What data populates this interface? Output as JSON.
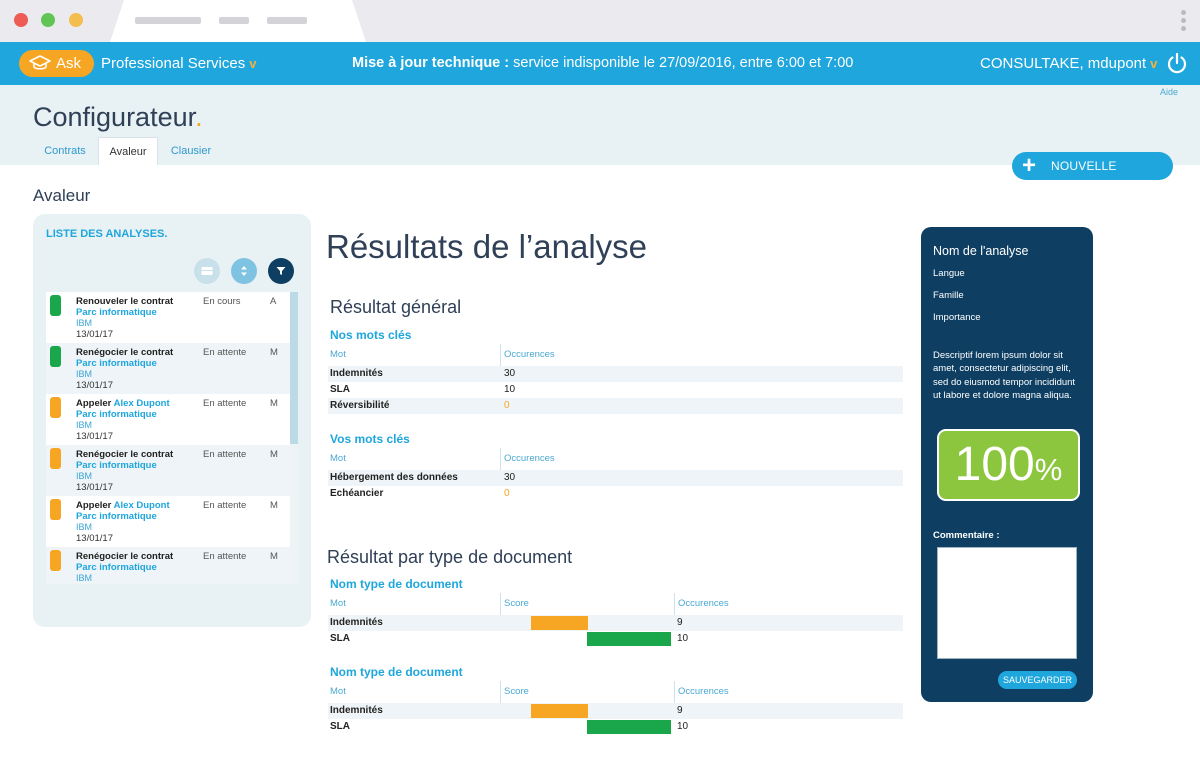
{
  "browser": {},
  "topbar": {
    "ask_label": "Ask",
    "org": "Professional Services",
    "org_chevron": "v",
    "notice_bold": "Mise à jour technique :",
    "notice_text": " service indisponible le 27/09/2016, entre 6:00 et 7:00",
    "user": "CONSULTAKE, mdupont",
    "user_chevron": "v",
    "help": "Aide"
  },
  "header": {
    "title": "Configurateur",
    "title_dot": ".",
    "tabs": [
      {
        "label": "Contrats"
      },
      {
        "label": "Avaleur"
      },
      {
        "label": "Clausier"
      }
    ],
    "new_button": "NOUVELLE ANALYSE"
  },
  "section_title": "Avaleur",
  "list": {
    "title": "LISTE DES ANALYSES.",
    "items": [
      {
        "action": "Renouveler le contrat",
        "person": "",
        "sub": "Parc informatique",
        "client": "IBM",
        "date": "13/01/17",
        "status": "En cours",
        "code": "A",
        "color": "#1aa64a"
      },
      {
        "action": "Renégocier le contrat",
        "person": "",
        "sub": "Parc informatique",
        "client": "IBM",
        "date": "13/01/17",
        "status": "En attente",
        "code": "M",
        "color": "#1aa64a"
      },
      {
        "action": "Appeler ",
        "person": "Alex Dupont",
        "sub": "Parc informatique",
        "client": "IBM",
        "date": "13/01/17",
        "status": "En attente",
        "code": "M",
        "color": "#f6a623"
      },
      {
        "action": "Renégocier le contrat",
        "person": "",
        "sub": "Parc informatique",
        "client": "IBM",
        "date": "13/01/17",
        "status": "En attente",
        "code": "M",
        "color": "#f6a623"
      },
      {
        "action": "Appeler ",
        "person": "Alex Dupont",
        "sub": "Parc informatique",
        "client": "IBM",
        "date": "13/01/17",
        "status": "En attente",
        "code": "M",
        "color": "#f6a623"
      },
      {
        "action": "Renégocier le contrat",
        "person": "",
        "sub": "Parc informatique",
        "client": "IBM",
        "date": "",
        "status": "En attente",
        "code": "M",
        "color": "#f6a623"
      }
    ]
  },
  "results": {
    "title": "Résultats de l’analyse",
    "general": {
      "title": "Résultat général",
      "ours": {
        "title": "Nos mots clés",
        "col_word": "Mot",
        "col_occ": "Occurences",
        "rows": [
          {
            "word": "Indemnités",
            "occ": "30"
          },
          {
            "word": "SLA",
            "occ": "10"
          },
          {
            "word": "Réversibilité",
            "occ": "0"
          }
        ]
      },
      "yours": {
        "title": "Vos mots clés",
        "col_word": "Mot",
        "col_occ": "Occurences",
        "rows": [
          {
            "word": "Hébergement des données",
            "occ": "30"
          },
          {
            "word": "Echéancier",
            "occ": "0"
          }
        ]
      }
    },
    "by_type": {
      "title": "Résultat par type de document",
      "groups": [
        {
          "title": "Nom type de document",
          "col_word": "Mot",
          "col_score": "Score",
          "col_occ": "Occurences",
          "rows": [
            {
              "word": "Indemnités",
              "occ": "9",
              "score_fill": 0.33,
              "color": "#f6a623"
            },
            {
              "word": "SLA",
              "occ": "10",
              "score_fill": 1.0,
              "color": "#1aa64a"
            }
          ]
        },
        {
          "title": "Nom type de document",
          "col_word": "Mot",
          "col_score": "Score",
          "col_occ": "Occurences",
          "rows": [
            {
              "word": "Indemnités",
              "occ": "9",
              "score_fill": 0.33,
              "color": "#f6a623"
            },
            {
              "word": "SLA",
              "occ": "10",
              "score_fill": 1.0,
              "color": "#1aa64a"
            }
          ]
        }
      ]
    }
  },
  "side": {
    "name_label": "Nom de l'analyse",
    "langue": "Langue",
    "famille": "Famille",
    "importance": "Importance",
    "description": "Descriptif lorem ipsum dolor sit amet, consectetur adipiscing elit, sed do eiusmod tempor incididunt ut labore et dolore magna aliqua.",
    "score_value": "100",
    "score_unit": "%",
    "comment_label": "Commentaire :",
    "comment_value": "",
    "save_label": "SAUVEGARDER"
  },
  "colors": {
    "brand_blue": "#1ea6dd",
    "accent_orange": "#f6a623",
    "ok_green": "#1aa64a",
    "score_green": "#8cc63e",
    "dark_navy": "#0e3f63"
  }
}
